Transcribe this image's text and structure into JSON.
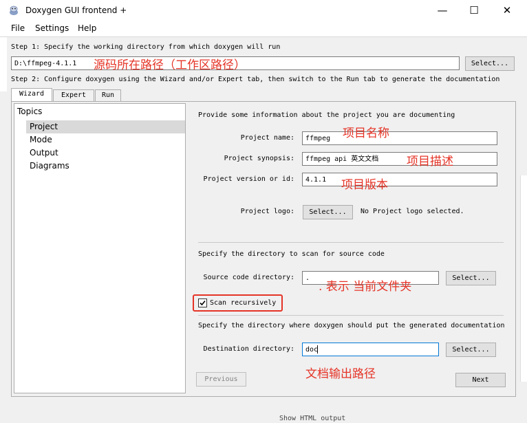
{
  "window": {
    "title": "Doxygen GUI frontend +",
    "minimize": "—",
    "maximize": "☐",
    "close": "✕"
  },
  "menu": [
    "File",
    "Settings",
    "Help"
  ],
  "step1": {
    "label": "Step 1: Specify the working directory from which doxygen will run",
    "value": "D:\\ffmpeg-4.1.1",
    "select": "Select..."
  },
  "step2": {
    "label": "Step 2: Configure doxygen using the Wizard and/or Expert tab, then switch to the Run tab to generate the documentation"
  },
  "tabs": [
    "Wizard",
    "Expert",
    "Run"
  ],
  "topics": {
    "header": "Topics",
    "items": [
      "Project",
      "Mode",
      "Output",
      "Diagrams"
    ]
  },
  "project": {
    "intro": "Provide some information about the project you are documenting",
    "name_label": "Project name:",
    "name_value": "ffmpeg",
    "synopsis_label": "Project synopsis:",
    "synopsis_value": "ffmpeg api 英文文档",
    "version_label": "Project version or id:",
    "version_value": "4.1.1",
    "logo_label": "Project logo:",
    "logo_button": "Select...",
    "logo_status": "No Project logo selected.",
    "source_intro": "Specify the directory to scan for source code",
    "source_label": "Source code directory:",
    "source_value": ".",
    "source_button": "Select...",
    "scan_label": "Scan recursively",
    "scan_checked": true,
    "dest_intro": "Specify the directory where doxygen should put the generated documentation",
    "dest_label": "Destination directory:",
    "dest_value": "doc",
    "dest_button": "Select...",
    "previous": "Previous",
    "next": "Next"
  },
  "annotations": {
    "workdir": "源码所在路径（工作区路径）",
    "name": "项目名称",
    "synopsis": "项目描述",
    "version": "项目版本",
    "source": ". 表示 当前文件夹",
    "dest": "文档输出路径"
  },
  "bottom_text": "Show HTML output",
  "colors": {
    "annotation": "#e53326",
    "highlight_box": "#e53326"
  }
}
